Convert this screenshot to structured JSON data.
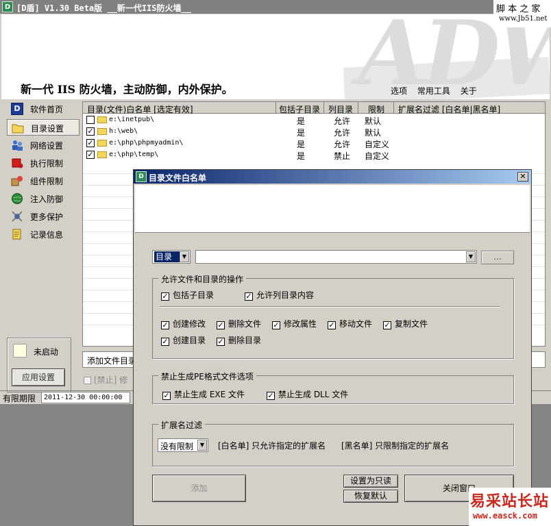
{
  "window": {
    "title": "[D盾] V1.30 Beta版  __新一代IIS防火墙__",
    "logo": "D"
  },
  "watermark_top": {
    "line1": "脚 本 之 家",
    "line2": "www.Jb51.net"
  },
  "banner": {
    "slogan": "新一代 IIS 防火墙，主动防御，内外保护。",
    "art": "ADW"
  },
  "menu": [
    "选项",
    "常用工具",
    "关于"
  ],
  "sidebar": {
    "items": [
      {
        "label": "软件首页",
        "icon": "d-logo-icon"
      },
      {
        "label": "目录设置",
        "icon": "folder-icon",
        "active": true
      },
      {
        "label": "网络设置",
        "icon": "network-users-icon"
      },
      {
        "label": "执行限制",
        "icon": "red-box-icon"
      },
      {
        "label": "组件限制",
        "icon": "components-icon"
      },
      {
        "label": "注入防御",
        "icon": "globe-icon"
      },
      {
        "label": "更多保护",
        "icon": "satellite-icon"
      },
      {
        "label": "记录信息",
        "icon": "log-icon"
      }
    ],
    "status_text": "未启动",
    "apply_button": "应用设置"
  },
  "list": {
    "headers": [
      "目录(文件)白名单 [选定有效]",
      "包括子目录",
      "列目录",
      "限制",
      "扩展名过滤 [白名单|黑名单]"
    ],
    "rows": [
      {
        "checked": false,
        "path": "e:\\inetpub\\",
        "subdir": "是",
        "listdir": "允许",
        "limit": "默认"
      },
      {
        "checked": true,
        "path": "h:\\web\\",
        "subdir": "是",
        "listdir": "允许",
        "limit": "默认"
      },
      {
        "checked": true,
        "path": "e:\\php\\phpmyadmin\\",
        "subdir": "是",
        "listdir": "允许",
        "limit": "自定义"
      },
      {
        "checked": true,
        "path": "e:\\php\\temp\\",
        "subdir": "是",
        "listdir": "禁止",
        "limit": "自定义"
      }
    ]
  },
  "bottom_bar_text": "添加文件目录",
  "forbid_text": "[禁止] 修",
  "status_bar": {
    "label": "有限期限",
    "value": "2011-12-30 00:00:00"
  },
  "dialog": {
    "title": "目录文件白名单",
    "type_select": "目录",
    "path_value": "",
    "browse_button": "...",
    "group_ops": {
      "title": "允许文件和目录的操作",
      "include_sub": "包括子目录",
      "allow_list": "允许列目录内容",
      "ops": [
        "创建修改",
        "删除文件",
        "修改属性",
        "移动文件",
        "复制文件",
        "创建目录",
        "删除目录"
      ]
    },
    "group_pe": {
      "title": "禁止生成PE格式文件选项",
      "exe": "禁止生成 EXE 文件",
      "dll": "禁止生成 DLL 文件"
    },
    "group_ext": {
      "title": "扩展名过滤",
      "select": "没有限制",
      "white_desc": "[白名单] 只允许指定的扩展名",
      "black_desc": "[黑名单] 只限制指定的扩展名"
    },
    "buttons": {
      "add": "添加",
      "readonly": "设置为只读",
      "restore": "恢复默认",
      "close": "关闭窗口"
    }
  },
  "watermark_bottom": {
    "line1": "易采站长站",
    "line2": "www.easck.com"
  },
  "colors": {
    "dialog_title_start": "#0a246a",
    "dialog_title_end": "#a6caf0",
    "watermark_red": "#c8281e"
  }
}
